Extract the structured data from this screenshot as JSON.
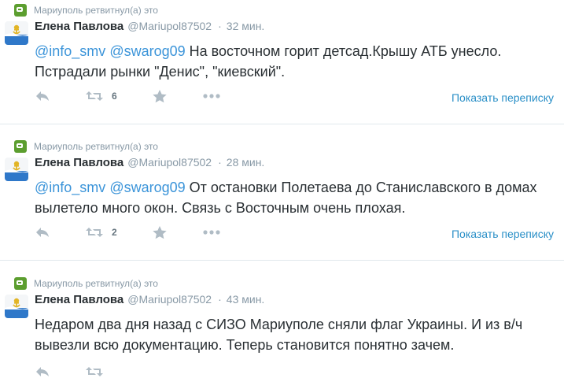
{
  "tweets": [
    {
      "retweet_text": "Мариуполь ретвитнул(а) это",
      "fullname": "Елена Павлова",
      "username": "@Mariupol87502",
      "dot": "·",
      "time": "32 мин.",
      "mentions": [
        "@info_smv",
        "@swarog09"
      ],
      "text": "На восточном горит детсад.Крышу АТБ унесло. Пстрадали рынки \"Денис\", \"киевский\".",
      "retweet_count": "6",
      "conversation_label": "Показать переписку"
    },
    {
      "retweet_text": "Мариуполь ретвитнул(а) это",
      "fullname": "Елена Павлова",
      "username": "@Mariupol87502",
      "dot": "·",
      "time": "28 мин.",
      "mentions": [
        "@info_smv",
        "@swarog09"
      ],
      "text": "От остановки Полетаева до Станиславского в домах вылетело много окон. Связь с Восточным очень плохая.",
      "retweet_count": "2",
      "conversation_label": "Показать переписку"
    },
    {
      "retweet_text": "Мариуполь ретвитнул(а) это",
      "fullname": "Елена Павлова",
      "username": "@Mariupol87502",
      "dot": "·",
      "time": "43 мин.",
      "mentions": [],
      "text": "Недаром два дня назад с СИЗО Мариуполе сняли флаг Украины. И из в/ч вывезли всю документацию. Теперь становится понятно зачем.",
      "retweet_count": "",
      "conversation_label": ""
    }
  ],
  "colors": {
    "link": "#3b94d9",
    "muted": "#8899a6",
    "retweet_badge": "#5c9e2f"
  }
}
